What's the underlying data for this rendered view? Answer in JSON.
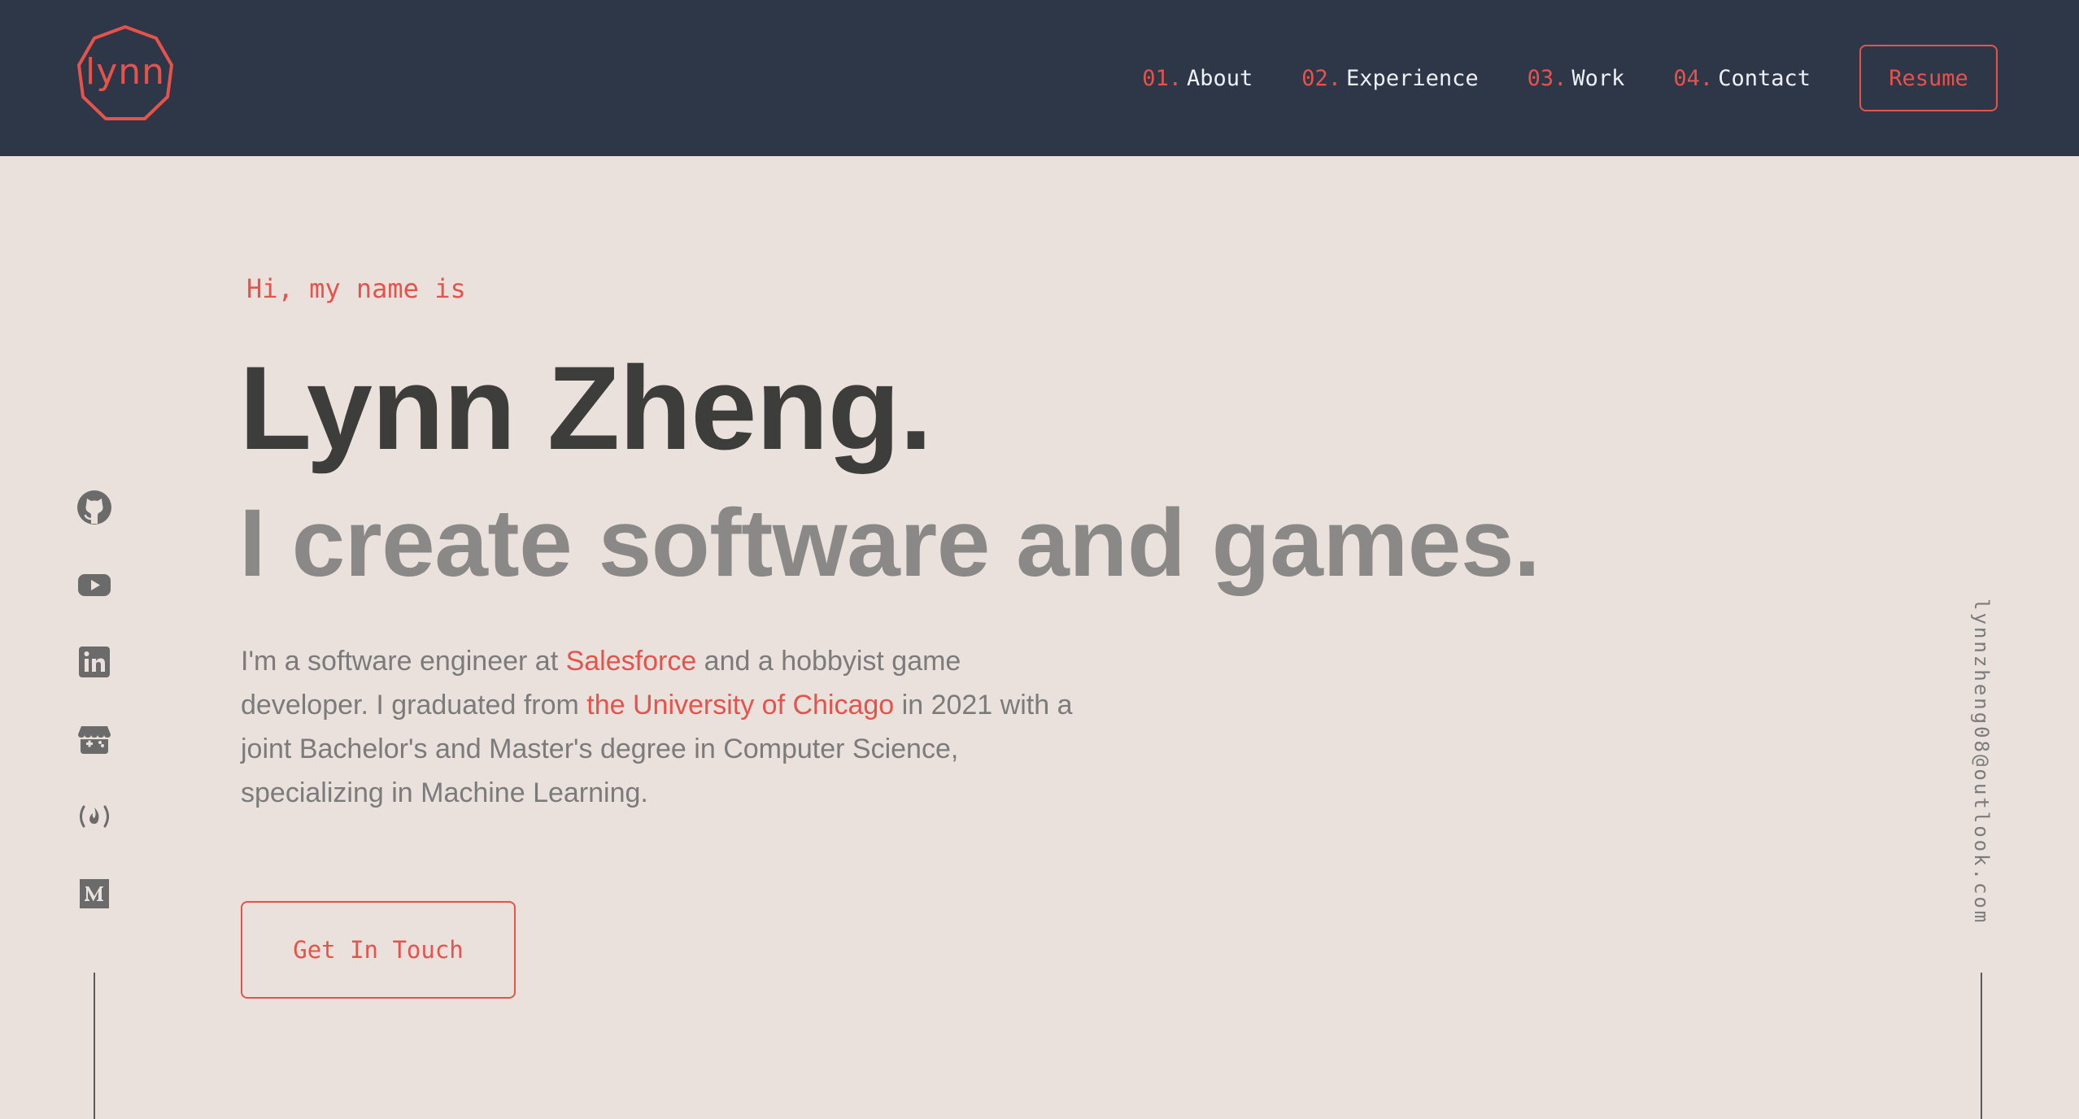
{
  "brand": {
    "logo_text": "lynn",
    "accent_color": "#e5534b",
    "header_color": "#2d3748",
    "background_color": "#eae1dd"
  },
  "nav": {
    "items": [
      {
        "num": "01.",
        "label": "About"
      },
      {
        "num": "02.",
        "label": "Experience"
      },
      {
        "num": "03.",
        "label": "Work"
      },
      {
        "num": "04.",
        "label": "Contact"
      }
    ],
    "resume_label": "Resume"
  },
  "hero": {
    "greeting": "Hi, my name is",
    "name": "Lynn Zheng.",
    "tagline": "I create software and games.",
    "bio": {
      "part1": "I'm a software engineer at ",
      "link1": "Salesforce",
      "part2": " and a hobbyist game developer. I graduated from ",
      "link2": "the University of Chicago",
      "part3": " in 2021 with a joint Bachelor's and Master's degree in Computer Science, specializing in Machine Learning."
    },
    "cta_label": "Get In Touch"
  },
  "socials": [
    "github-icon",
    "youtube-icon",
    "linkedin-icon",
    "itchio-icon",
    "freecodecamp-icon",
    "medium-icon"
  ],
  "email": "lynnzheng08@outlook.com"
}
